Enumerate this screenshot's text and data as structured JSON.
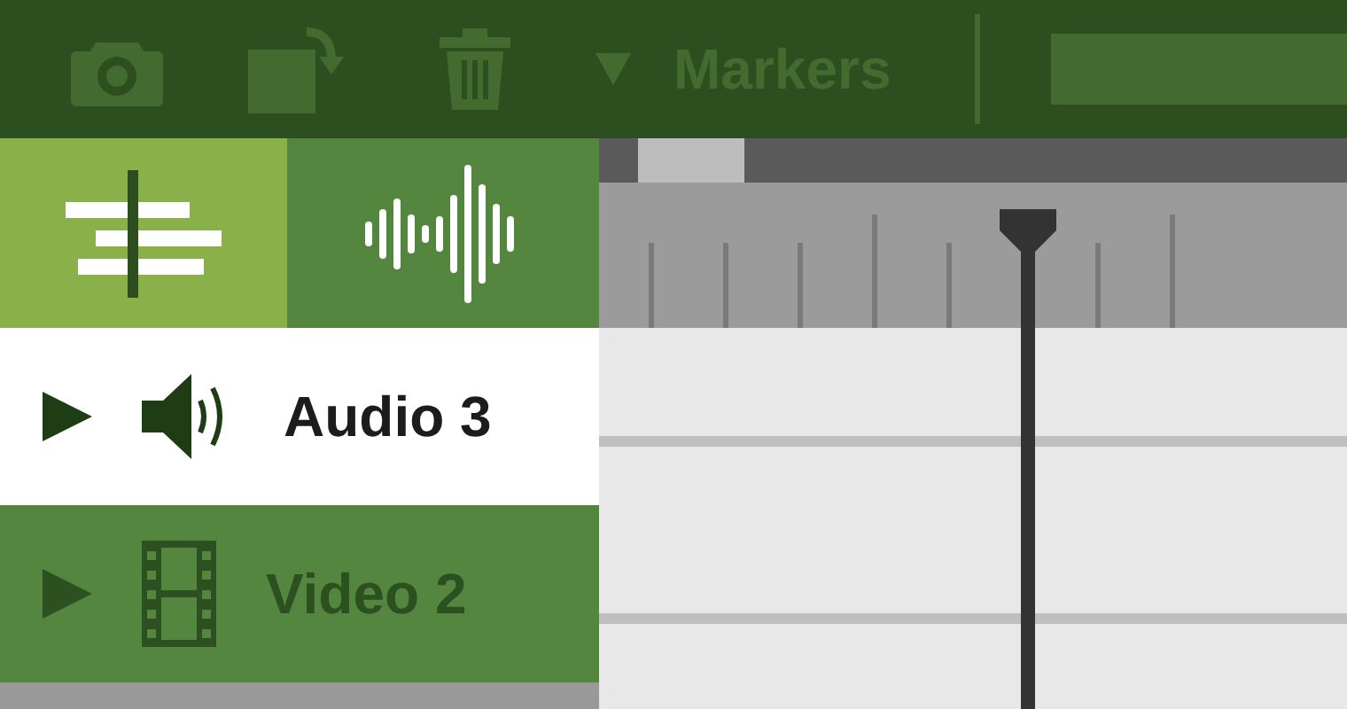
{
  "toolbar": {
    "markers_label": "Markers"
  },
  "tabs": [
    {
      "kind": "trim",
      "selected": true
    },
    {
      "kind": "waveform",
      "selected": false
    }
  ],
  "tracks": [
    {
      "kind": "audio",
      "name": "Audio 3",
      "selected": true
    },
    {
      "kind": "video",
      "name": "Video 2",
      "selected": false
    }
  ]
}
